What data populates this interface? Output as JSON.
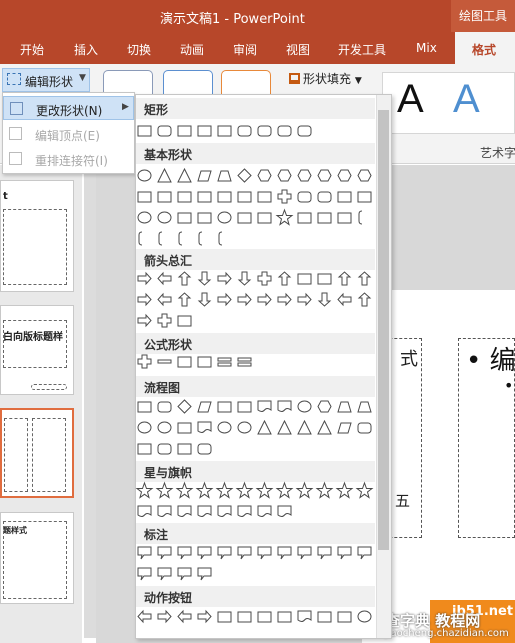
{
  "titlebar": {
    "doc_title": "演示文稿1  -  PowerPoint",
    "contextual_tools": "绘图工具"
  },
  "tabs": [
    {
      "label": "开始"
    },
    {
      "label": "插入"
    },
    {
      "label": "切换"
    },
    {
      "label": "动画"
    },
    {
      "label": "审阅"
    },
    {
      "label": "视图"
    },
    {
      "label": "开发工具"
    },
    {
      "label": "Mix"
    }
  ],
  "active_tab": "格式",
  "ribbon": {
    "edit_shape": "编辑形状",
    "shape_fill": "形状填充",
    "art_letters": [
      "A",
      "A"
    ],
    "art_group_label": "艺术字"
  },
  "edit_menu": {
    "items": [
      {
        "label": "更改形状(N)",
        "enabled": true,
        "submenu": true
      },
      {
        "label": "编辑顶点(E)",
        "enabled": false
      },
      {
        "label": "重排连接符(I)",
        "enabled": false
      }
    ]
  },
  "gallery": {
    "sections": [
      {
        "title": "矩形",
        "shapes": [
          "rect",
          "round-rect",
          "snip1-rect",
          "snip2-rect",
          "snip-diag-rect",
          "snip-round-rect",
          "round1-rect",
          "round2-rect",
          "round-diag-rect"
        ]
      },
      {
        "title": "基本形状",
        "shapes": [
          "oval",
          "triangle",
          "right-triangle",
          "parallelogram",
          "trapezoid",
          "diamond",
          "pentagon",
          "hexagon",
          "heptagon",
          "octagon",
          "decagon",
          "dodecagon",
          "pie",
          "chord",
          "teardrop",
          "frame",
          "half-frame",
          "l-shape",
          "diagonal-stripe",
          "cross",
          "plaque",
          "can",
          "cube",
          "bevel",
          "donut",
          "no-symbol",
          "block-arc",
          "folded-corner",
          "smiley",
          "heart",
          "lightning",
          "sun",
          "moon",
          "cloud",
          "arc",
          "double-bracket",
          "double-brace",
          "left-bracket",
          "right-bracket",
          "left-brace",
          "right-brace"
        ]
      },
      {
        "title": "箭头总汇",
        "shapes": [
          "right-arrow",
          "left-arrow",
          "up-arrow",
          "down-arrow",
          "left-right-arrow",
          "up-down-arrow",
          "quad-arrow",
          "left-right-up-arrow",
          "bent-arrow",
          "u-turn-arrow",
          "left-up-arrow",
          "bent-up-arrow",
          "curved-right-arrow",
          "curved-left-arrow",
          "curved-up-arrow",
          "curved-down-arrow",
          "striped-right-arrow",
          "notched-right-arrow",
          "pentagon-arrow",
          "chevron",
          "right-arrow-callout",
          "down-arrow-callout",
          "left-arrow-callout",
          "up-arrow-callout",
          "left-right-arrow-callout",
          "quad-arrow-callout",
          "circular-arrow"
        ]
      },
      {
        "title": "公式形状",
        "shapes": [
          "plus",
          "minus",
          "multiply",
          "divide",
          "equal",
          "not-equal"
        ]
      },
      {
        "title": "流程图",
        "shapes": [
          "process",
          "alternate-process",
          "decision",
          "data",
          "predefined-process",
          "internal-storage",
          "document",
          "multidocument",
          "terminator",
          "preparation",
          "manual-input",
          "manual-operation",
          "connector",
          "off-page-connector",
          "card",
          "punched-tape",
          "summing-junction",
          "or",
          "collate",
          "sort",
          "extract",
          "merge",
          "stored-data",
          "delay",
          "sequential-access",
          "magnetic-disk",
          "direct-access",
          "display"
        ]
      },
      {
        "title": "星与旗帜",
        "shapes": [
          "explosion1",
          "explosion2",
          "star4",
          "star5",
          "star6",
          "star7",
          "star8",
          "star10",
          "star12",
          "star16",
          "star24",
          "star32",
          "ribbon-up",
          "ribbon-down",
          "curved-ribbon-up",
          "curved-ribbon-down",
          "vertical-scroll",
          "horizontal-scroll",
          "wave",
          "double-wave"
        ]
      },
      {
        "title": "标注",
        "shapes": [
          "rect-callout",
          "round-rect-callout",
          "oval-callout",
          "cloud-callout",
          "line-callout1",
          "line-callout2",
          "line-callout3",
          "accent-callout1",
          "accent-callout2",
          "accent-callout3",
          "border-callout1",
          "border-callout2",
          "border-callout3",
          "accent-border-callout1",
          "accent-border-callout2",
          "accent-border-callout3"
        ]
      },
      {
        "title": "动作按钮",
        "shapes": [
          "action-back",
          "action-forward",
          "action-beginning",
          "action-end",
          "action-home",
          "action-information",
          "action-return",
          "action-movie",
          "action-document",
          "action-sound",
          "action-help",
          "action-custom"
        ]
      }
    ]
  },
  "slides_panel": {
    "thumb_texts": [
      "t",
      "白向版标题样",
      "",
      "题样式"
    ]
  },
  "slide": {
    "bullet_main": "• 编",
    "bullet_sub": "•",
    "char_left": "式",
    "char_wu": "五"
  },
  "watermark": {
    "top": "jb51.net",
    "mid": "查字典 教程网",
    "bottom": "jiaocheng.chazidian.com"
  },
  "colors": {
    "title_bar": "#b7472a",
    "ribbon_bg": "#f3f3f3",
    "hover_blue": "#cfe2f6",
    "art_a_blue": "#4f8fd0",
    "selected_thumb": "#e06d3f"
  }
}
